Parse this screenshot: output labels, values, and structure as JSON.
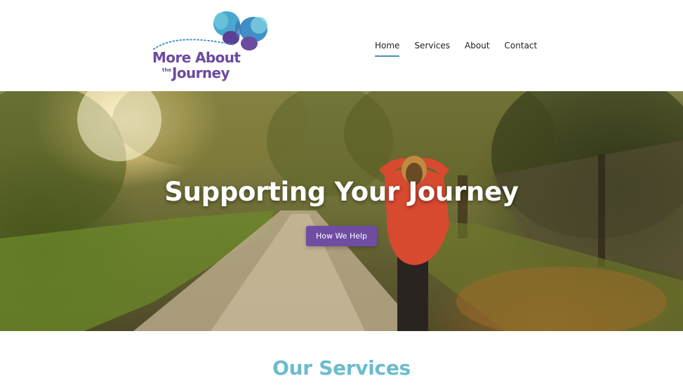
{
  "brand": {
    "line1": "More About",
    "the": "the",
    "line2": "Journey",
    "colors": {
      "purple": "#6b4aa0",
      "blue": "#3f8fc6",
      "teal": "#6bbccc"
    }
  },
  "nav": {
    "items": [
      {
        "label": "Home",
        "active": true
      },
      {
        "label": "Services",
        "active": false
      },
      {
        "label": "About",
        "active": false
      },
      {
        "label": "Contact",
        "active": false
      }
    ]
  },
  "hero": {
    "title": "Supporting Your Journey",
    "cta_label": "How We Help",
    "cta_color": "#6f4da3"
  },
  "services": {
    "title": "Our Services"
  },
  "icons": {
    "logo_mark": "butterfly-icon"
  }
}
